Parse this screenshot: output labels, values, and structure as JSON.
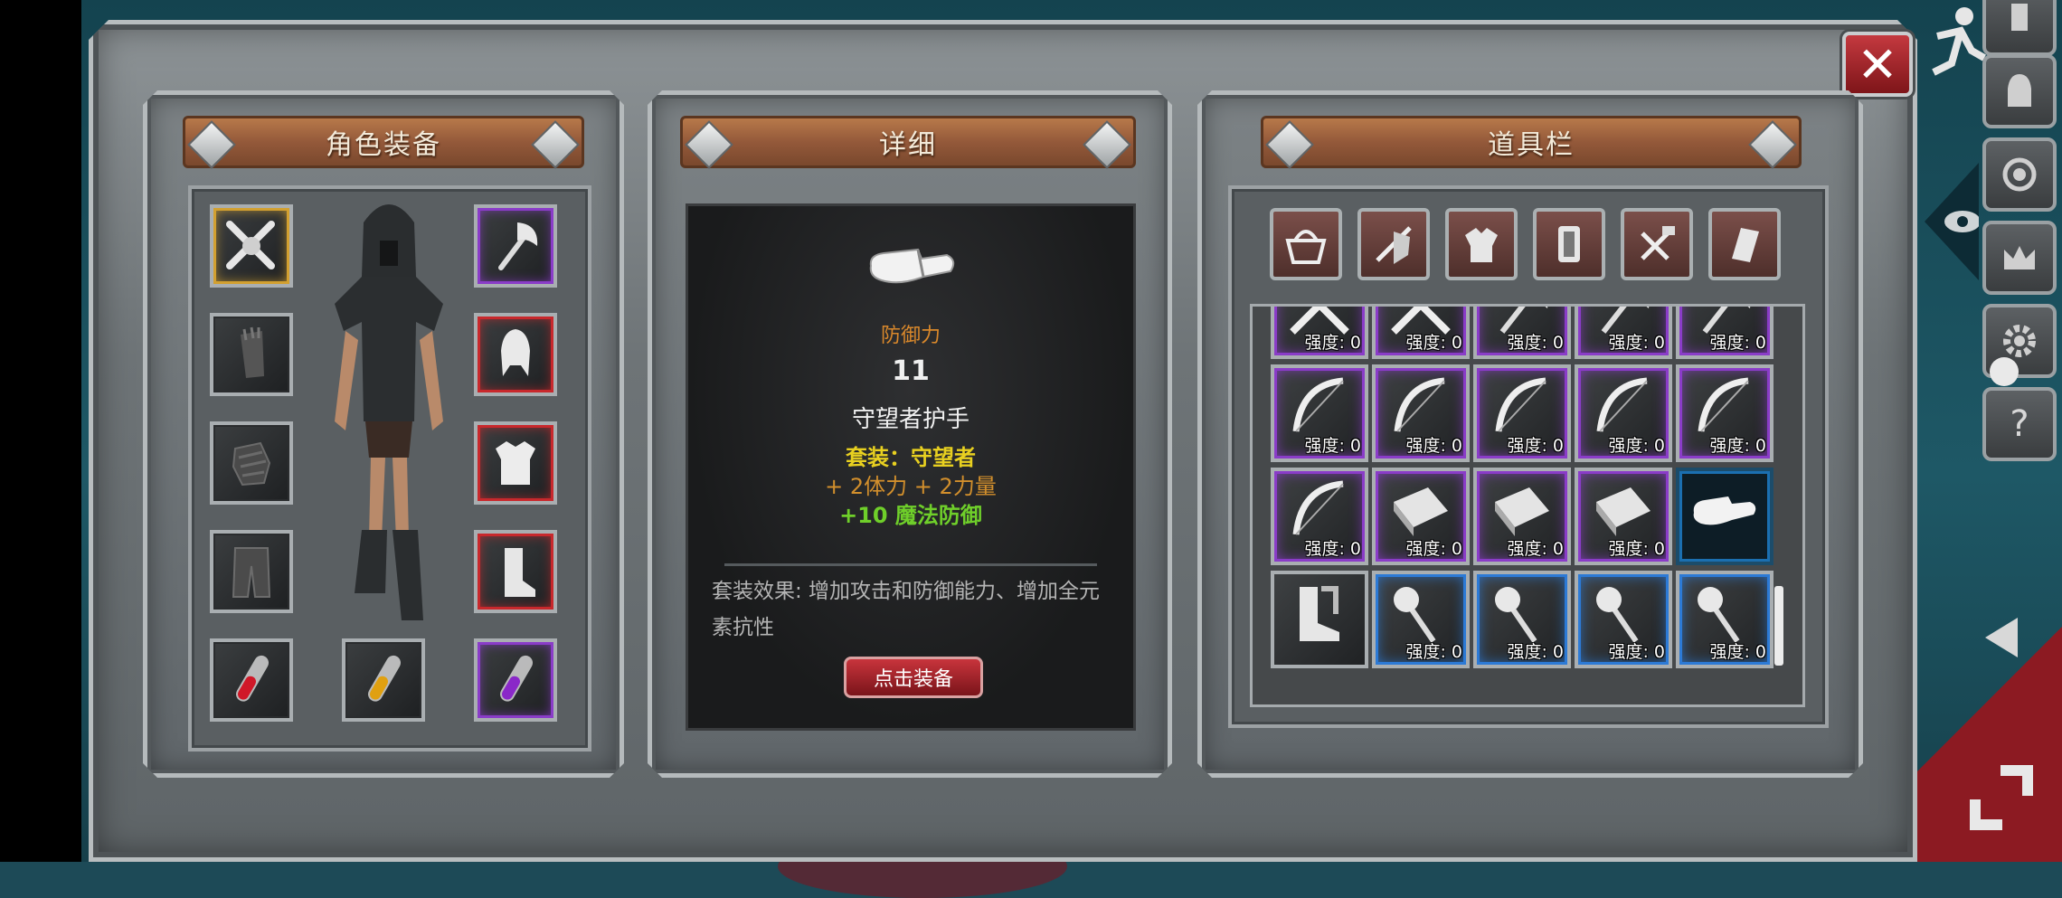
{
  "panels": {
    "equipment_title": "角色装备",
    "detail_title": "详细",
    "inventory_title": "道具栏"
  },
  "detail": {
    "stat_label": "防御力",
    "stat_value": "11",
    "item_name": "守望者护手",
    "set_name": "套装：守望者",
    "bonus_1": "+ 2体力 + 2力量",
    "bonus_2": "+10 魔法防御",
    "set_effect": "套装效果: 增加攻击和防御能力、增加全元素抗性",
    "equip_button": "点击装备"
  },
  "inventory": {
    "strength_label": "强度: 0"
  },
  "colors": {
    "rarity_purple": "#8a3cc8",
    "rarity_blue": "#2c7ad6",
    "rarity_gold": "#d2a030",
    "rarity_red": "#c8282c",
    "stat_orange": "#d9882b",
    "set_yellow": "#e8d020",
    "bonus_green": "#6fcf2a"
  }
}
